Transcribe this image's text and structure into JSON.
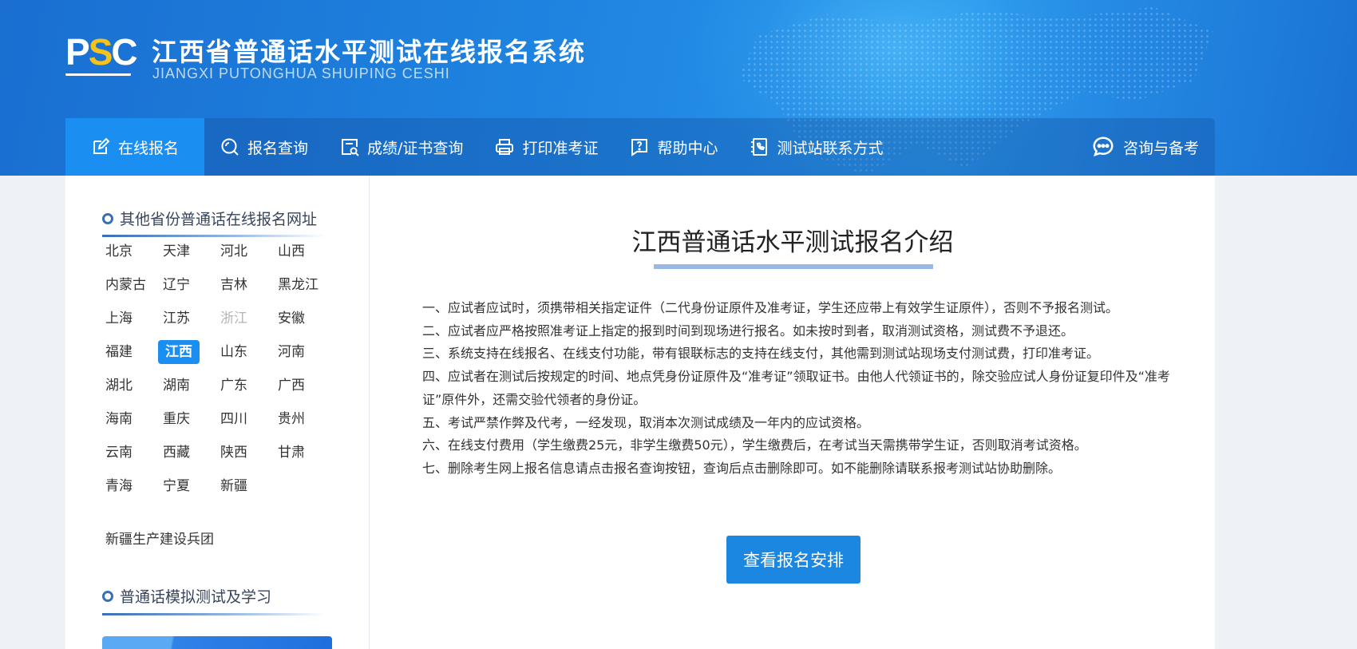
{
  "header": {
    "logo_text": "PSC",
    "title": "江西省普通话水平测试在线报名系统",
    "subtitle": "JIANGXI PUTONGHUA SHUIPING CESHI"
  },
  "nav": {
    "items": [
      {
        "label": "在线报名",
        "icon": "edit-icon"
      },
      {
        "label": "报名查询",
        "icon": "search-icon"
      },
      {
        "label": "成绩/证书查询",
        "icon": "certificate-search-icon"
      },
      {
        "label": "打印准考证",
        "icon": "printer-icon"
      },
      {
        "label": "帮助中心",
        "icon": "help-icon"
      },
      {
        "label": "测试站联系方式",
        "icon": "phone-book-icon"
      }
    ],
    "consult": {
      "label": "咨询与备考",
      "icon": "chat-icon"
    },
    "active_color": "#1b8ef1"
  },
  "sidebar": {
    "provinces_title": "其他省份普通话在线报名网址",
    "provinces": [
      "北京",
      "天津",
      "河北",
      "山西",
      "内蒙古",
      "辽宁",
      "吉林",
      "黑龙江",
      "上海",
      "江苏",
      "浙江",
      "安徽",
      "福建",
      "江西",
      "山东",
      "河南",
      "湖北",
      "湖南",
      "广东",
      "广西",
      "海南",
      "重庆",
      "四川",
      "贵州",
      "云南",
      "西藏",
      "陕西",
      "甘肃",
      "青海",
      "宁夏",
      "新疆"
    ],
    "selected": "江西",
    "disabled": [
      "浙江"
    ],
    "extra": "新疆生产建设兵团",
    "sim_title": "普通话模拟测试及学习"
  },
  "main": {
    "title": "江西普通话水平测试报名介绍",
    "rules": [
      "一、应试者应试时，须携带相关指定证件（二代身份证原件及准考证，学生还应带上有效学生证原件），否则不予报名测试。",
      "二、应试者应严格按照准考证上指定的报到时间到现场进行报名。如未按时到者，取消测试资格，测试费不予退还。",
      "三、系统支持在线报名、在线支付功能，带有银联标志的支持在线支付，其他需到测试站现场支付测试费，打印准考证。",
      "四、应试者在测试后按规定的时间、地点凭身份证原件及“准考证”领取证书。由他人代领证书的，除交验应试人身份证复印件及“准考证”原件外，还需交验代领者的身份证。",
      "五、考试严禁作弊及代考，一经发现，取消本次测试成绩及一年内的应试资格。",
      "六、在线支付费用（学生缴费25元，非学生缴费50元），学生缴费后，在考试当天需携带学生证，否则取消考试资格。",
      "七、删除考生网上报名信息请点击报名查询按钮，查询后点击删除即可。如不能删除请联系报考测试站协助删除。"
    ],
    "cta_label": "查看报名安排"
  }
}
